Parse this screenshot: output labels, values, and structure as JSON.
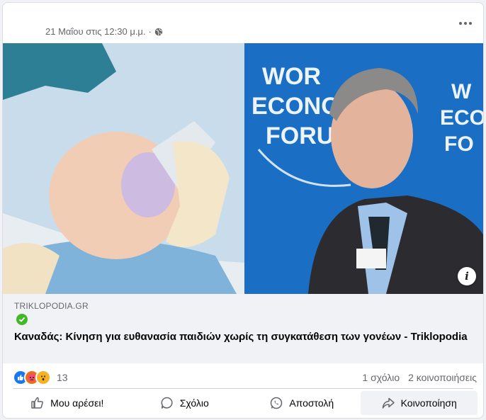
{
  "post": {
    "timestamp": "21 Μαΐου στις 12:30 μ.μ.",
    "separator": "·",
    "privacy_icon": "globe-icon"
  },
  "link": {
    "domain": "TRIKLOPODIA.GR",
    "verified_icon": "verified-check-icon",
    "title": "Καναδάς: Κίνηση για ευθανασία παιδιών χωρίς τη συγκατάθεση των γονέων - Triklopodia",
    "image_info": "i"
  },
  "stats": {
    "reaction_count": "13",
    "comments": "1 σχόλιο",
    "shares": "2 κοινοποιήσεις",
    "reaction_icons": [
      "like-icon",
      "angry-icon",
      "wow-icon"
    ],
    "colors": {
      "like": "#1877f2",
      "angry": "#e9710f",
      "wow": "#f7b125"
    }
  },
  "actions": {
    "like": "Μου αρέσει!",
    "comment": "Σχόλιο",
    "send": "Αποστολή",
    "share": "Κοινοποίηση"
  }
}
